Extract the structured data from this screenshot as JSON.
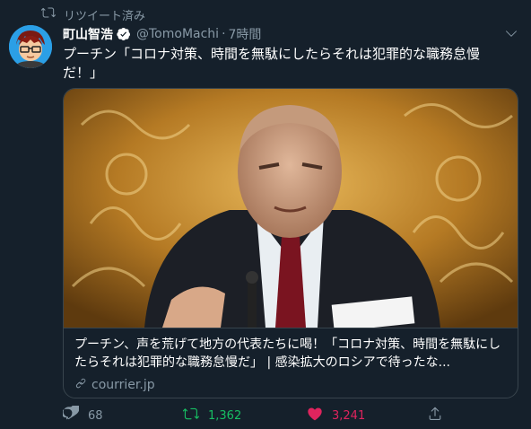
{
  "retweet_notice": {
    "icon": "retweet-icon",
    "label": "リツイート済み"
  },
  "author": {
    "name": "町山智浩",
    "handle": "@TomoMachi",
    "separator": "·",
    "time": "7時間",
    "verified": true
  },
  "tweet": {
    "text": "プーチン「コロナ対策、時間を無駄にしたらそれは犯罪的な職務怠慢だ！」"
  },
  "card": {
    "title": "プーチン、声を荒げて地方の代表たちに喝！「コロナ対策、時間を無駄にしたらそれは犯罪的な職務怠慢だ」 | 感染拡大のロシアで待ったな...",
    "domain": "courrier.jp"
  },
  "actions": {
    "reply_count": "68",
    "retweet_count": "1,362",
    "like_count": "3,241"
  },
  "colors": {
    "background": "#15202b",
    "muted": "#8899a6",
    "retweet_active": "#17bf63",
    "like_active": "#e0245e",
    "border": "#38444d"
  }
}
